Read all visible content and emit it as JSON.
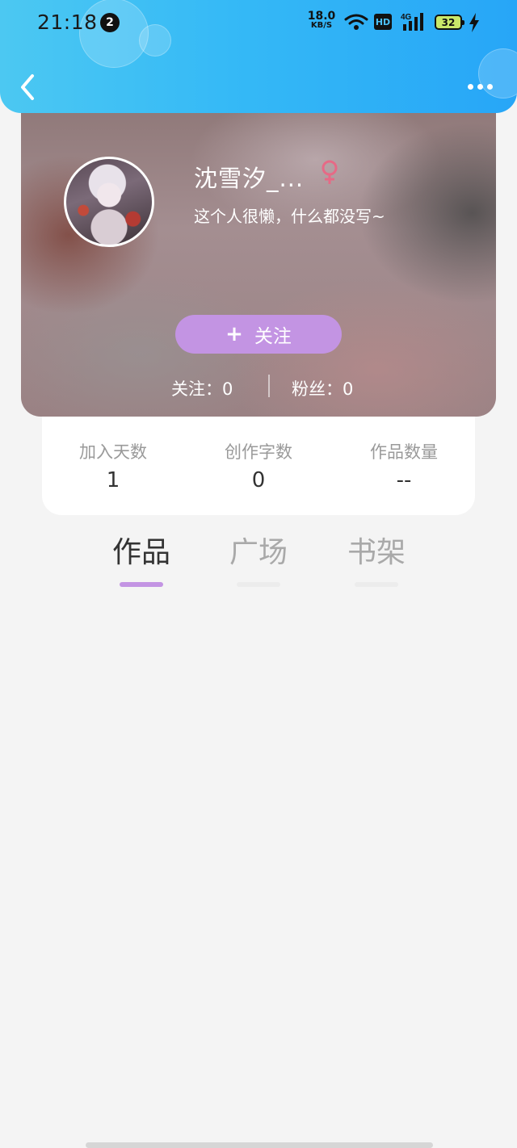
{
  "status_bar": {
    "time": "21:18",
    "notification_count": "2",
    "net_speed_value": "18.0",
    "net_speed_unit": "KB/S",
    "hd_label": "HD",
    "signal_label": "4G",
    "battery_level": "32",
    "icons": [
      "wifi-icon",
      "hd-icon",
      "signal-icon",
      "battery-icon",
      "charging-bolt-icon"
    ]
  },
  "nav": {
    "back_icon": "chevron-left-icon",
    "more_icon": "more-dots-icon"
  },
  "profile": {
    "username": "沈雪汐_...",
    "gender_symbol": "♀",
    "bio": "这个人很懒，什么都没写~",
    "follow_button_label": "关注",
    "follow_button_icon": "+",
    "following_text": "关注：0",
    "fans_text": "粉丝：0"
  },
  "stats": [
    {
      "label": "加入天数",
      "value": "1"
    },
    {
      "label": "创作字数",
      "value": "0"
    },
    {
      "label": "作品数量",
      "value": "--"
    }
  ],
  "tabs": [
    {
      "label": "作品",
      "active": true
    },
    {
      "label": "广场",
      "active": false
    },
    {
      "label": "书架",
      "active": false
    }
  ],
  "colors": {
    "header_gradient_start": "#4cc8f2",
    "header_gradient_end": "#27a6f7",
    "accent_purple": "#c394e3",
    "gender_female": "#e66a86",
    "page_background": "#f4f4f4"
  }
}
